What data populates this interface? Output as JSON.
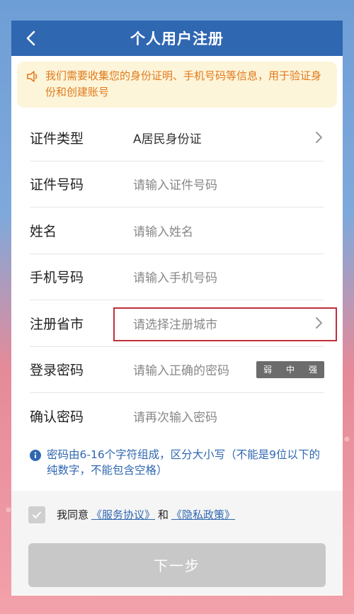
{
  "header": {
    "title": "个人用户注册"
  },
  "notice": {
    "text": "我们需要收集您的身份证明、手机号码等信息，用于验证身份和创建账号"
  },
  "form": {
    "id_type": {
      "label": "证件类型",
      "value": "A居民身份证"
    },
    "id_number": {
      "label": "证件号码",
      "placeholder": "请输入证件号码"
    },
    "name": {
      "label": "姓名",
      "placeholder": "请输入姓名"
    },
    "phone": {
      "label": "手机号码",
      "placeholder": "请输入手机号码"
    },
    "region": {
      "label": "注册省市",
      "placeholder": "请选择注册城市"
    },
    "password": {
      "label": "登录密码",
      "placeholder": "请输入正确的密码",
      "strength": [
        "弱",
        "中",
        "强"
      ]
    },
    "confirm_password": {
      "label": "确认密码",
      "placeholder": "请再次输入密码"
    }
  },
  "hint": {
    "text": "密码由6-16个字符组成，区分大小写（不能是9位以下的纯数字，不能包含空格）"
  },
  "agreement": {
    "prefix": "我同意",
    "service_link": "《服务协议》",
    "and": "和",
    "privacy_link": "《隐私政策》"
  },
  "next_button": {
    "label": "下一步"
  },
  "colors": {
    "header": "#2f67b1",
    "notice_bg": "#fdf5d9",
    "notice_text": "#e07a1f",
    "highlight_border": "#c0303a",
    "disabled_button": "#c8c8c8"
  }
}
